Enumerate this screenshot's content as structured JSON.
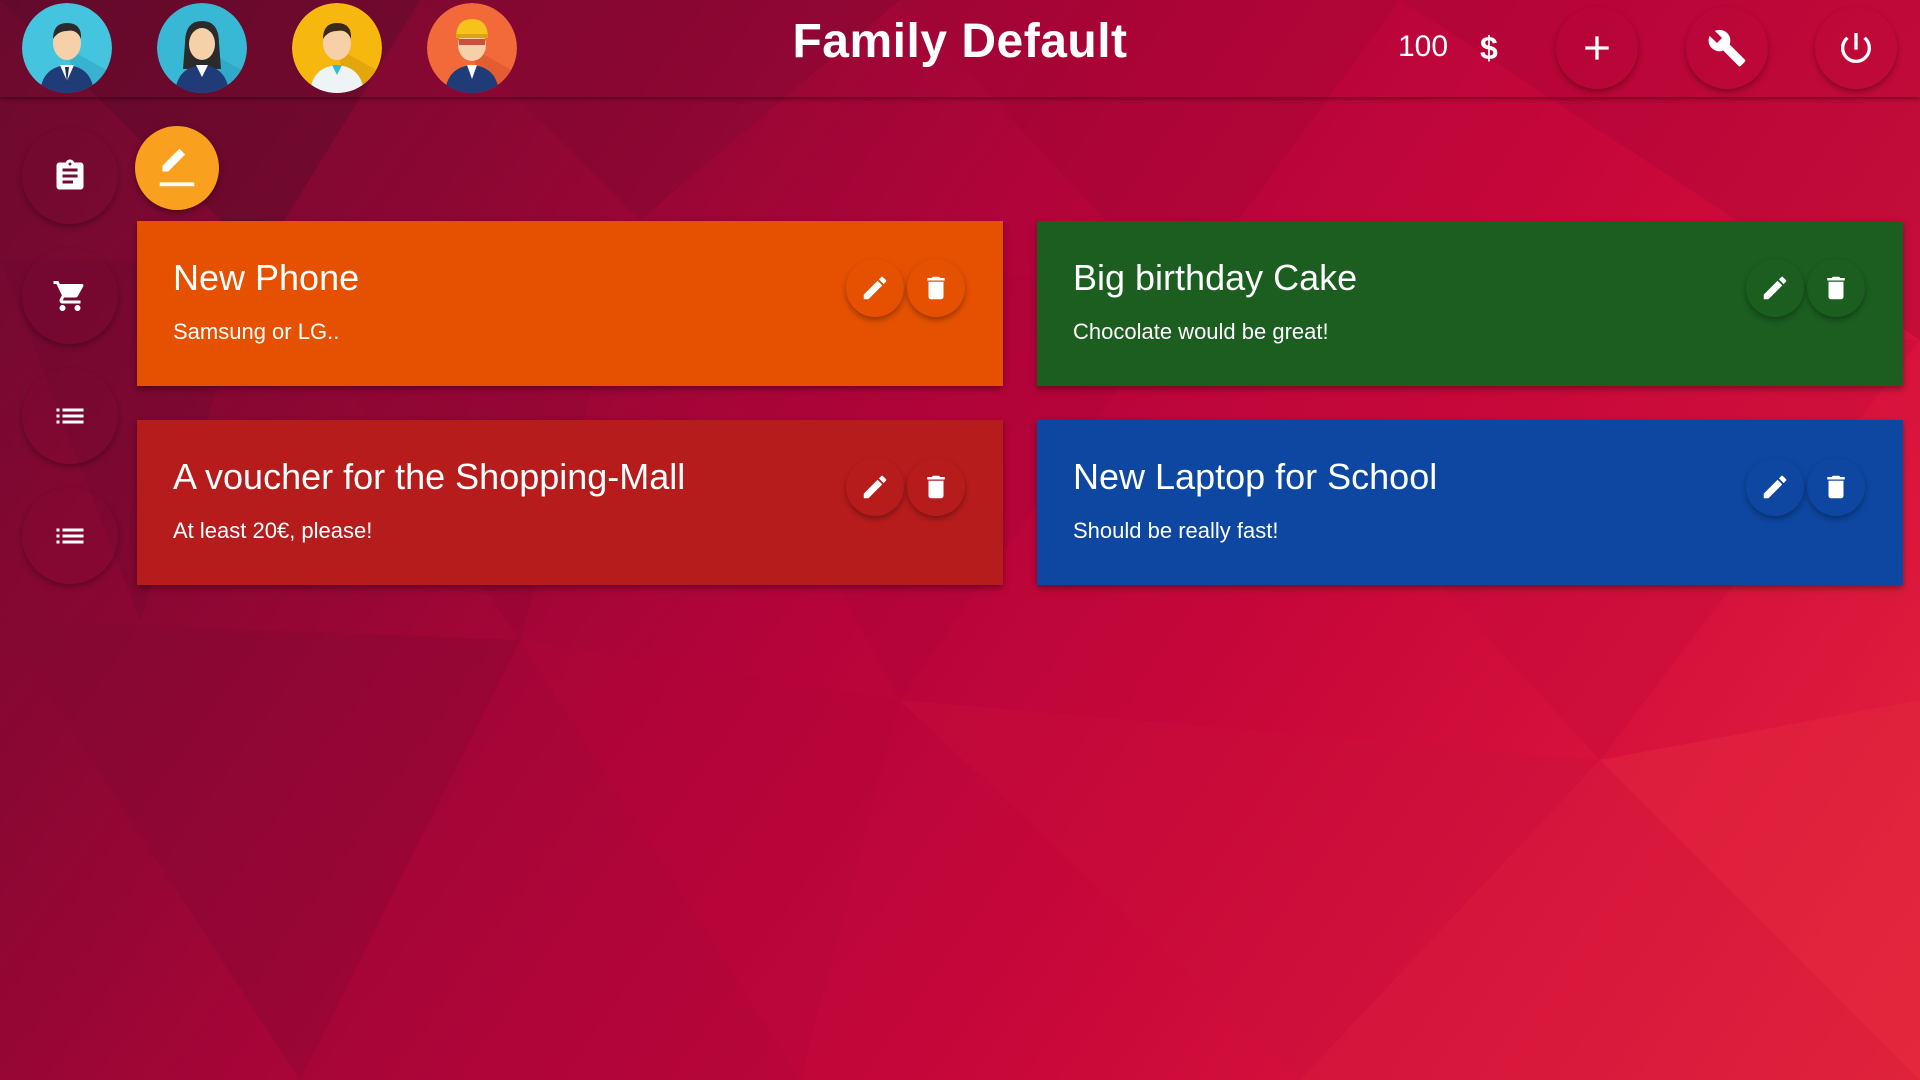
{
  "header": {
    "title": "Family Default",
    "balance": "100",
    "currency": "$",
    "avatars": [
      {
        "icon": "man-avatar-icon",
        "bg": "#45c4e0"
      },
      {
        "icon": "woman-avatar-icon",
        "bg": "#39b8d6"
      },
      {
        "icon": "doctor-avatar-icon",
        "bg": "#f6b80f"
      },
      {
        "icon": "worker-avatar-icon",
        "bg": "#f26a3a"
      }
    ],
    "actions": [
      {
        "name": "add-button",
        "icon": "plus-icon"
      },
      {
        "name": "settings-button",
        "icon": "wrench-icon"
      },
      {
        "name": "power-button",
        "icon": "power-icon"
      }
    ]
  },
  "sidebar": {
    "items": [
      {
        "name": "sidebar-item-wishlist",
        "icon": "clipboard-icon"
      },
      {
        "name": "sidebar-item-shopping",
        "icon": "cart-icon"
      },
      {
        "name": "sidebar-item-list-1",
        "icon": "list-icon"
      },
      {
        "name": "sidebar-item-list-2",
        "icon": "list-icon"
      }
    ]
  },
  "fab": {
    "icon": "edit-icon",
    "color": "#f9a01f"
  },
  "cards": [
    {
      "title": "New Phone",
      "description": "Samsung or LG..",
      "color": "#e55100"
    },
    {
      "title": "Big birthday Cake",
      "description": "Chocolate would be great!",
      "color": "#1b5e20"
    },
    {
      "title": "A voucher for the Shopping-Mall",
      "description": "At least 20€, please!",
      "color": "#b71c1c"
    },
    {
      "title": "New Laptop for School",
      "description": "Should be really fast!",
      "color": "#0d47a1"
    }
  ]
}
